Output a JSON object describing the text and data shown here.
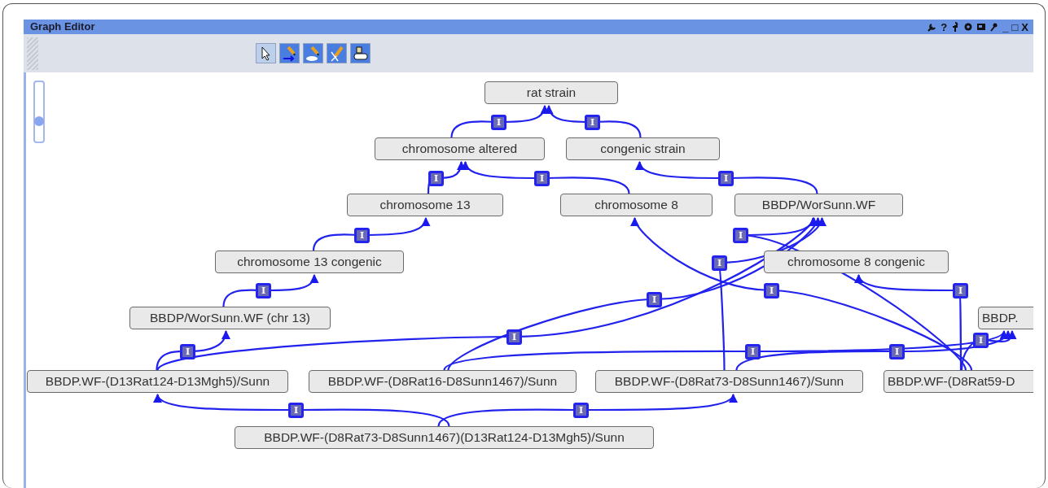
{
  "window": {
    "title": "Graph Editor",
    "controls": [
      {
        "kind": "wrench"
      },
      {
        "kind": "text",
        "label": "?"
      },
      {
        "kind": "pin"
      },
      {
        "kind": "gear"
      },
      {
        "kind": "screen"
      },
      {
        "kind": "key"
      },
      {
        "kind": "text",
        "label": "_"
      },
      {
        "kind": "text",
        "label": "□"
      },
      {
        "kind": "text",
        "label": "X"
      }
    ]
  },
  "toolbar": {
    "tools": [
      {
        "kind": "select",
        "selected": true
      },
      {
        "kind": "draw-edge",
        "selected": false
      },
      {
        "kind": "draw-node",
        "selected": false
      },
      {
        "kind": "cut-edge",
        "selected": false
      },
      {
        "kind": "stamp",
        "selected": false
      }
    ]
  },
  "zoom_slider": {
    "level": 0.33
  },
  "graph": {
    "nodes": [
      {
        "label": "rat strain"
      },
      {
        "label": "chromosome altered"
      },
      {
        "label": "congenic strain"
      },
      {
        "label": "chromosome 13"
      },
      {
        "label": "chromosome 8"
      },
      {
        "label": "BBDP/WorSunn.WF"
      },
      {
        "label": "chromosome 13 congenic"
      },
      {
        "label": "chromosome 8 congenic"
      },
      {
        "label": "BBDP/WorSunn.WF (chr 13)"
      },
      {
        "label": "BBDP."
      },
      {
        "label": "BBDP.WF-(D13Rat124-D13Mgh5)/Sunn"
      },
      {
        "label": "BBDP.WF-(D8Rat16-D8Sunn1467)/Sunn"
      },
      {
        "label": "BBDP.WF-(D8Rat73-D8Sunn1467)/Sunn"
      },
      {
        "label": "BBDP.WF-(D8Rat59-D"
      },
      {
        "label": "BBDP.WF-(D8Rat73-D8Sunn1467)(D13Rat124-D13Mgh5)/Sunn"
      }
    ],
    "edges": [
      {
        "label": "I"
      },
      {
        "label": "I"
      },
      {
        "label": "I"
      },
      {
        "label": "I"
      },
      {
        "label": "I"
      },
      {
        "label": "I"
      },
      {
        "label": "I"
      },
      {
        "label": "I"
      },
      {
        "label": "I"
      },
      {
        "label": "I"
      },
      {
        "label": "I"
      },
      {
        "label": "I"
      },
      {
        "label": "I"
      },
      {
        "label": "I"
      },
      {
        "label": "I"
      },
      {
        "label": "I"
      },
      {
        "label": "I"
      },
      {
        "label": "I"
      },
      {
        "label": "I"
      }
    ]
  }
}
